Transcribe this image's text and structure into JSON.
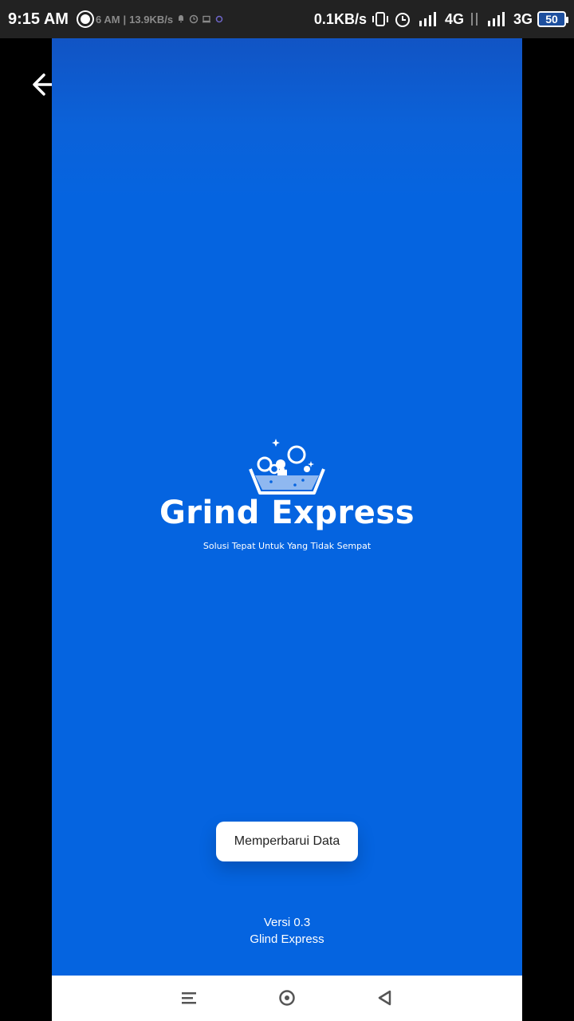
{
  "status_bar": {
    "time": "9:15 AM",
    "inner_time_fragment": "6 AM",
    "inner_speed": "13.9KB/s",
    "speed": "0.1KB/s",
    "network_1": "4G",
    "network_2": "3G",
    "battery": "50"
  },
  "app": {
    "brand_name": "Grind Express",
    "tagline": "Solusi Tepat Untuk Yang Tidak Sempat",
    "update_button_label": "Memperbarui Data",
    "version": "Versi 0.3",
    "app_name_footer": "Glind Express",
    "colors": {
      "background": "#0564e0",
      "button_bg": "#ffffff",
      "text": "#ffffff"
    }
  },
  "icons": {
    "back": "arrow-left-icon",
    "logo": "laundry-basket-bubbles-icon",
    "nav_menu": "menu-icon",
    "nav_home": "home-circle-icon",
    "nav_back": "triangle-back-icon"
  }
}
